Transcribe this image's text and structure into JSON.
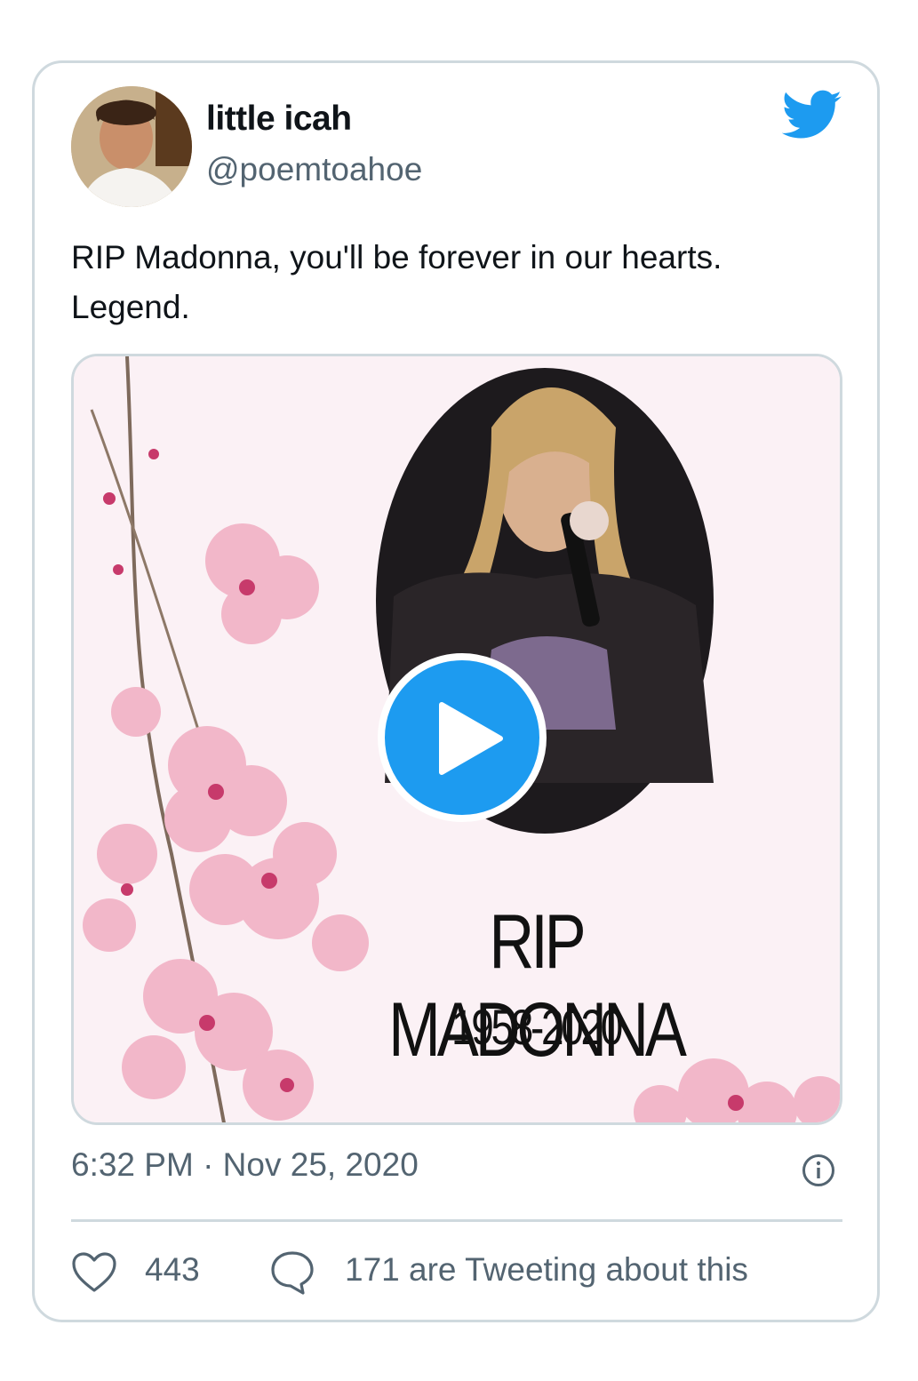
{
  "user": {
    "display_name": "little icah",
    "handle": "@poemtoahoe"
  },
  "tweet": {
    "text": "RIP Madonna, you'll be forever in our hearts. Legend."
  },
  "media": {
    "title": "RIP MADONNA",
    "years": "1958-2020",
    "play_icon": "play-icon"
  },
  "meta": {
    "timestamp": "6:32 PM · Nov 25, 2020",
    "likes": "443",
    "tweeting": "171 are Tweeting about this"
  },
  "colors": {
    "twitter_blue": "#1d9bf0",
    "secondary_text": "#536471",
    "border": "#cfd9de"
  },
  "icons": [
    "twitter-bird-icon",
    "info-icon",
    "heart-icon",
    "comment-icon"
  ]
}
